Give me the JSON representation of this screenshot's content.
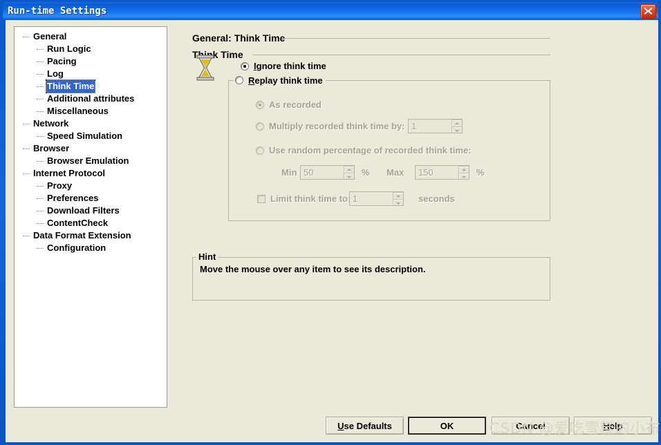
{
  "window": {
    "title": "Run-time Settings",
    "close_label": "×"
  },
  "tree": {
    "items": [
      {
        "label": "General",
        "level": 0,
        "selected": false
      },
      {
        "label": "Run Logic",
        "level": 1,
        "selected": false
      },
      {
        "label": "Pacing",
        "level": 1,
        "selected": false
      },
      {
        "label": "Log",
        "level": 1,
        "selected": false
      },
      {
        "label": "Think Time",
        "level": 1,
        "selected": true
      },
      {
        "label": "Additional attributes",
        "level": 1,
        "selected": false
      },
      {
        "label": "Miscellaneous",
        "level": 1,
        "selected": false
      },
      {
        "label": "Network",
        "level": 0,
        "selected": false
      },
      {
        "label": "Speed Simulation",
        "level": 1,
        "selected": false
      },
      {
        "label": "Browser",
        "level": 0,
        "selected": false
      },
      {
        "label": "Browser Emulation",
        "level": 1,
        "selected": false
      },
      {
        "label": "Internet Protocol",
        "level": 0,
        "selected": false
      },
      {
        "label": "Proxy",
        "level": 1,
        "selected": false
      },
      {
        "label": "Preferences",
        "level": 1,
        "selected": false
      },
      {
        "label": "Download Filters",
        "level": 1,
        "selected": false
      },
      {
        "label": "ContentCheck",
        "level": 1,
        "selected": false
      },
      {
        "label": "Data Format Extension",
        "level": 0,
        "selected": false
      },
      {
        "label": "Configuration",
        "level": 1,
        "selected": false
      }
    ]
  },
  "pane": {
    "header": "General: Think Time",
    "group_title": "Think Time",
    "icon": "hourglass-icon",
    "ignore_label": "Ignore think time",
    "ignore_accel": "I",
    "ignore_selected": true,
    "replay_label": "Replay think time",
    "replay_accel": "R",
    "replay_selected": false,
    "as_recorded_label": "As recorded",
    "as_recorded_selected": true,
    "multiply_label": "Multiply recorded think time by:",
    "multiply_value": "1",
    "multiply_selected": false,
    "random_label": "Use random percentage of recorded think time:",
    "random_selected": false,
    "min_label": "Min :",
    "min_value": "50",
    "min_unit": "%",
    "max_label": "Max",
    "max_value": "150",
    "max_unit": "%",
    "limit_label": "Limit think time to:",
    "limit_value": "1",
    "limit_unit": "seconds",
    "limit_checked": false
  },
  "hint": {
    "legend": "Hint",
    "text": "Move the mouse over any item to see its description."
  },
  "buttons": {
    "use_defaults": "Use Defaults",
    "ok": "OK",
    "cancel": "Cancel",
    "help": "Help"
  },
  "watermark": {
    "text": "CSDN @爱吃雪糕的小布丁"
  },
  "colors": {
    "face": "#ECE9DB",
    "title_blue": "#0A5BD2",
    "selection_blue": "#3366CC",
    "disabled_text": "#A6A396",
    "border": "#B5B3A4"
  }
}
